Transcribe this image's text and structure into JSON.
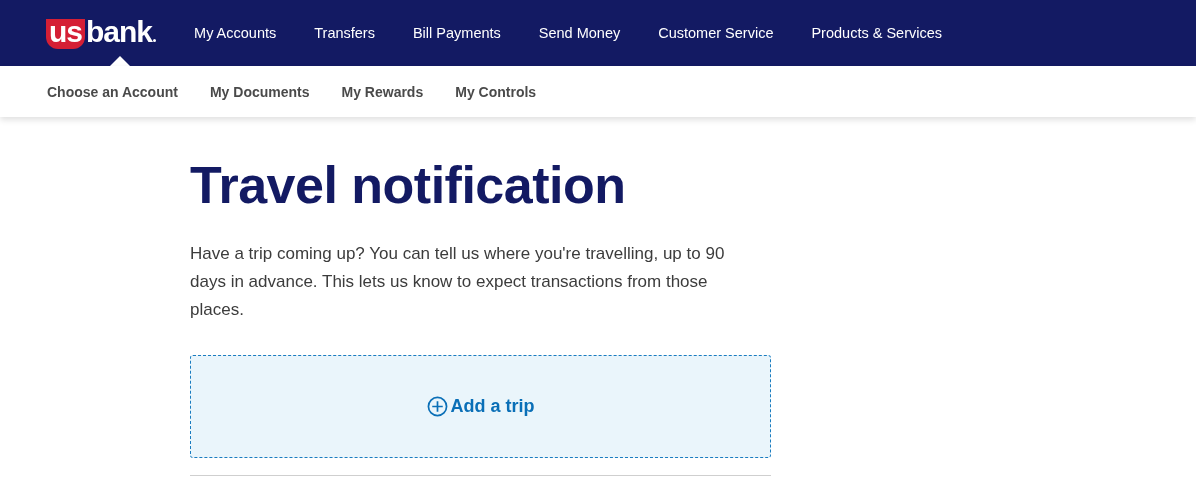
{
  "logo": {
    "shield_text": "us",
    "text": "bank"
  },
  "main_nav": [
    {
      "label": "My Accounts"
    },
    {
      "label": "Transfers"
    },
    {
      "label": "Bill Payments"
    },
    {
      "label": "Send Money"
    },
    {
      "label": "Customer Service"
    },
    {
      "label": "Products & Services"
    }
  ],
  "sub_nav": [
    {
      "label": "Choose an Account"
    },
    {
      "label": "My Documents"
    },
    {
      "label": "My Rewards"
    },
    {
      "label": "My Controls"
    }
  ],
  "page": {
    "title": "Travel notification",
    "description": "Have a trip coming up? You can tell us where you're travelling, up to 90 days in advance. This lets us know to expect transactions from those places.",
    "add_button": "Add a trip"
  }
}
